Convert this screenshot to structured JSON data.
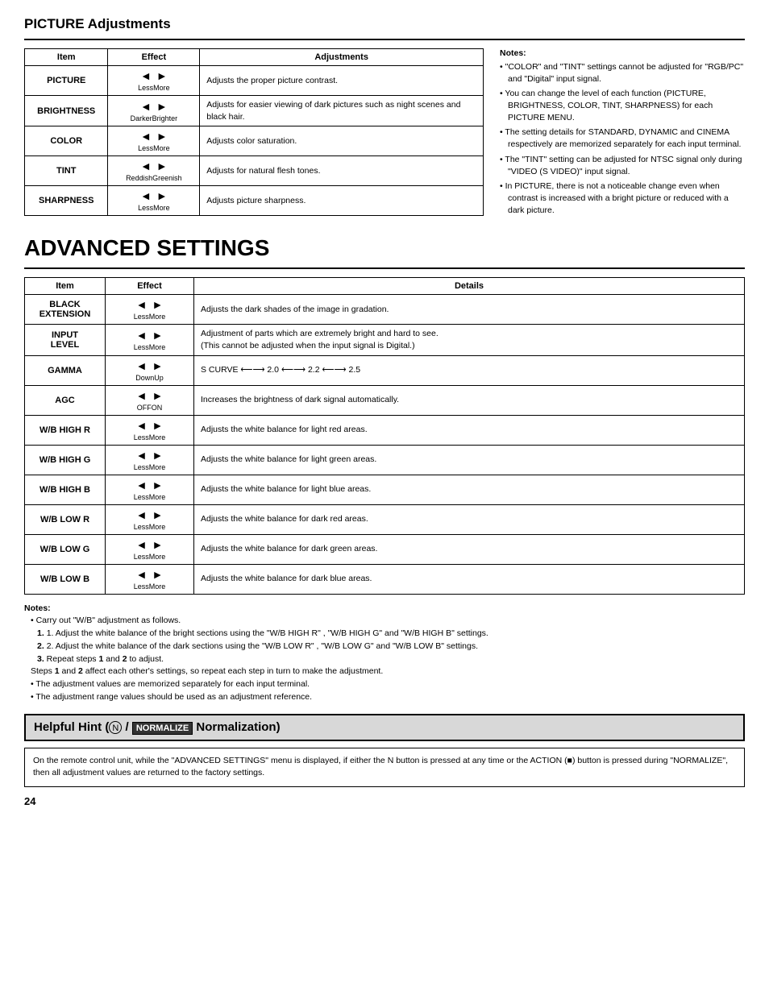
{
  "picture_section": {
    "title": "PICTURE Adjustments",
    "table": {
      "headers": [
        "Item",
        "Effect",
        "Adjustments"
      ],
      "rows": [
        {
          "item": "PICTURE",
          "effect_left": "◄",
          "effect_right": "►",
          "label_left": "Less",
          "label_right": "More",
          "adjustment": "Adjusts the proper picture contrast."
        },
        {
          "item": "BRIGHTNESS",
          "effect_left": "◄",
          "effect_right": "►",
          "label_left": "Darker",
          "label_right": "Brighter",
          "adjustment": "Adjusts for easier viewing of dark pictures such as night scenes and black hair."
        },
        {
          "item": "COLOR",
          "effect_left": "◄",
          "effect_right": "►",
          "label_left": "Less",
          "label_right": "More",
          "adjustment": "Adjusts color saturation."
        },
        {
          "item": "TINT",
          "effect_left": "◄",
          "effect_right": "►",
          "label_left": "Reddish",
          "label_right": "Greenish",
          "adjustment": "Adjusts for natural flesh tones."
        },
        {
          "item": "SHARPNESS",
          "effect_left": "◄",
          "effect_right": "►",
          "label_left": "Less",
          "label_right": "More",
          "adjustment": "Adjusts picture sharpness."
        }
      ]
    },
    "notes": {
      "title": "Notes:",
      "items": [
        "\"COLOR\" and \"TINT\" settings cannot be adjusted for \"RGB/PC\" and \"Digital\" input signal.",
        "You can change the level of each function (PICTURE, BRIGHTNESS, COLOR, TINT, SHARPNESS) for each PICTURE MENU.",
        "The setting details for STANDARD, DYNAMIC and CINEMA respectively are memorized separately for each input terminal.",
        "The \"TINT\" setting can be adjusted for NTSC signal only during \"VIDEO (S VIDEO)\" input signal.",
        "In PICTURE, there is not a noticeable change even when contrast is increased with a bright picture or reduced with a dark picture."
      ]
    }
  },
  "advanced_section": {
    "title": "ADVANCED SETTINGS",
    "table": {
      "headers": [
        "Item",
        "Effect",
        "Details"
      ],
      "rows": [
        {
          "item": "BLACK\nEXTENSION",
          "label_left": "Less",
          "label_right": "More",
          "details": "Adjusts the dark shades of the image in gradation."
        },
        {
          "item": "INPUT\nLEVEL",
          "label_left": "Less",
          "label_right": "More",
          "details": "Adjustment of parts which are extremely bright and hard to see.\n(This cannot be adjusted when the input signal is Digital.)"
        },
        {
          "item": "GAMMA",
          "label_left": "Down",
          "label_right": "Up",
          "details": "S CURVE ⟵⟶ 2.0 ⟵⟶ 2.2 ⟵⟶  2.5"
        },
        {
          "item": "AGC",
          "label_left": "OFF",
          "label_right": "ON",
          "details": "Increases the brightness of dark signal automatically."
        },
        {
          "item": "W/B HIGH R",
          "label_left": "Less",
          "label_right": "More",
          "details": "Adjusts the white balance for light red areas."
        },
        {
          "item": "W/B HIGH G",
          "label_left": "Less",
          "label_right": "More",
          "details": "Adjusts the white balance for light green areas."
        },
        {
          "item": "W/B HIGH B",
          "label_left": "Less",
          "label_right": "More",
          "details": "Adjusts the white balance for light blue areas."
        },
        {
          "item": "W/B LOW R",
          "label_left": "Less",
          "label_right": "More",
          "details": "Adjusts the white balance for dark red areas."
        },
        {
          "item": "W/B LOW G",
          "label_left": "Less",
          "label_right": "More",
          "details": "Adjusts the white balance for dark green areas."
        },
        {
          "item": "W/B LOW B",
          "label_left": "Less",
          "label_right": "More",
          "details": "Adjusts the white balance for dark blue areas."
        }
      ]
    },
    "bottom_notes": {
      "title": "Notes:",
      "bullet1": "Carry out \"W/B\" adjustment as follows.",
      "step1": "1. Adjust the white balance of the bright sections using the \"W/B HIGH R\" , \"W/B HIGH G\" and \"W/B HIGH B\" settings.",
      "step2": "2. Adjust the white balance of the dark sections using the \"W/B LOW R\" , \"W/B LOW G\" and \"W/B LOW B\" settings.",
      "step3": "3. Repeat steps 1 and 2 to adjust.",
      "affect_note": "Steps 1 and 2 affect each other's settings, so repeat each step in turn to make the adjustment.",
      "bullet2": "The adjustment values are memorized separately for each input terminal.",
      "bullet3": "The adjustment range values should be used as an adjustment reference."
    },
    "helpful_hint": {
      "title": "Helpful Hint (",
      "n_label": "N",
      "slash": " / ",
      "normalize_label": "NORMALIZE",
      "title_end": " Normalization)",
      "content": "On the remote control unit, while the \"ADVANCED SETTINGS\" menu is displayed, if either the N button is pressed at any time or the ACTION (■) button is pressed during \"NORMALIZE\", then all adjustment values are returned to the factory settings."
    }
  },
  "page_number": "24"
}
